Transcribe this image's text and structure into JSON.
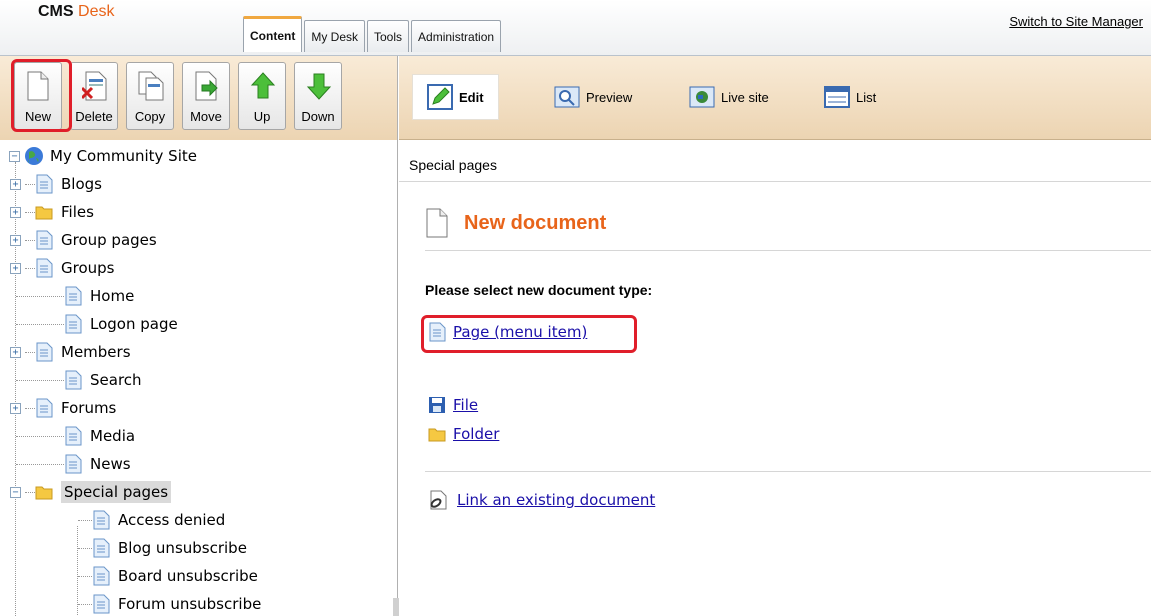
{
  "header": {
    "logo_cms": "CMS",
    "logo_desk": "Desk",
    "tabs": [
      "Content",
      "My Desk",
      "Tools",
      "Administration"
    ],
    "switch_link": "Switch to Site Manager"
  },
  "toolbar": {
    "buttons": [
      "New",
      "Delete",
      "Copy",
      "Move",
      "Up",
      "Down"
    ],
    "views": [
      "Edit",
      "Preview",
      "Live site",
      "List"
    ]
  },
  "tree": {
    "root": "My Community Site",
    "items": [
      "Blogs",
      "Files",
      "Group pages",
      "Groups",
      "Home",
      "Logon page",
      "Members",
      "Search",
      "Forums",
      "Media",
      "News",
      "Special pages"
    ],
    "children": [
      "Access denied",
      "Blog unsubscribe",
      "Board unsubscribe",
      "Forum unsubscribe"
    ]
  },
  "content": {
    "breadcrumb": "Special pages",
    "title": "New document",
    "prompt": "Please select new document type:",
    "doc_types": [
      "Page (menu item)",
      "File",
      "Folder"
    ],
    "link_existing": "Link an existing document"
  },
  "colors": {
    "accent": "#e8641a",
    "highlight": "#e01e2a",
    "link": "#1a0fa8"
  }
}
